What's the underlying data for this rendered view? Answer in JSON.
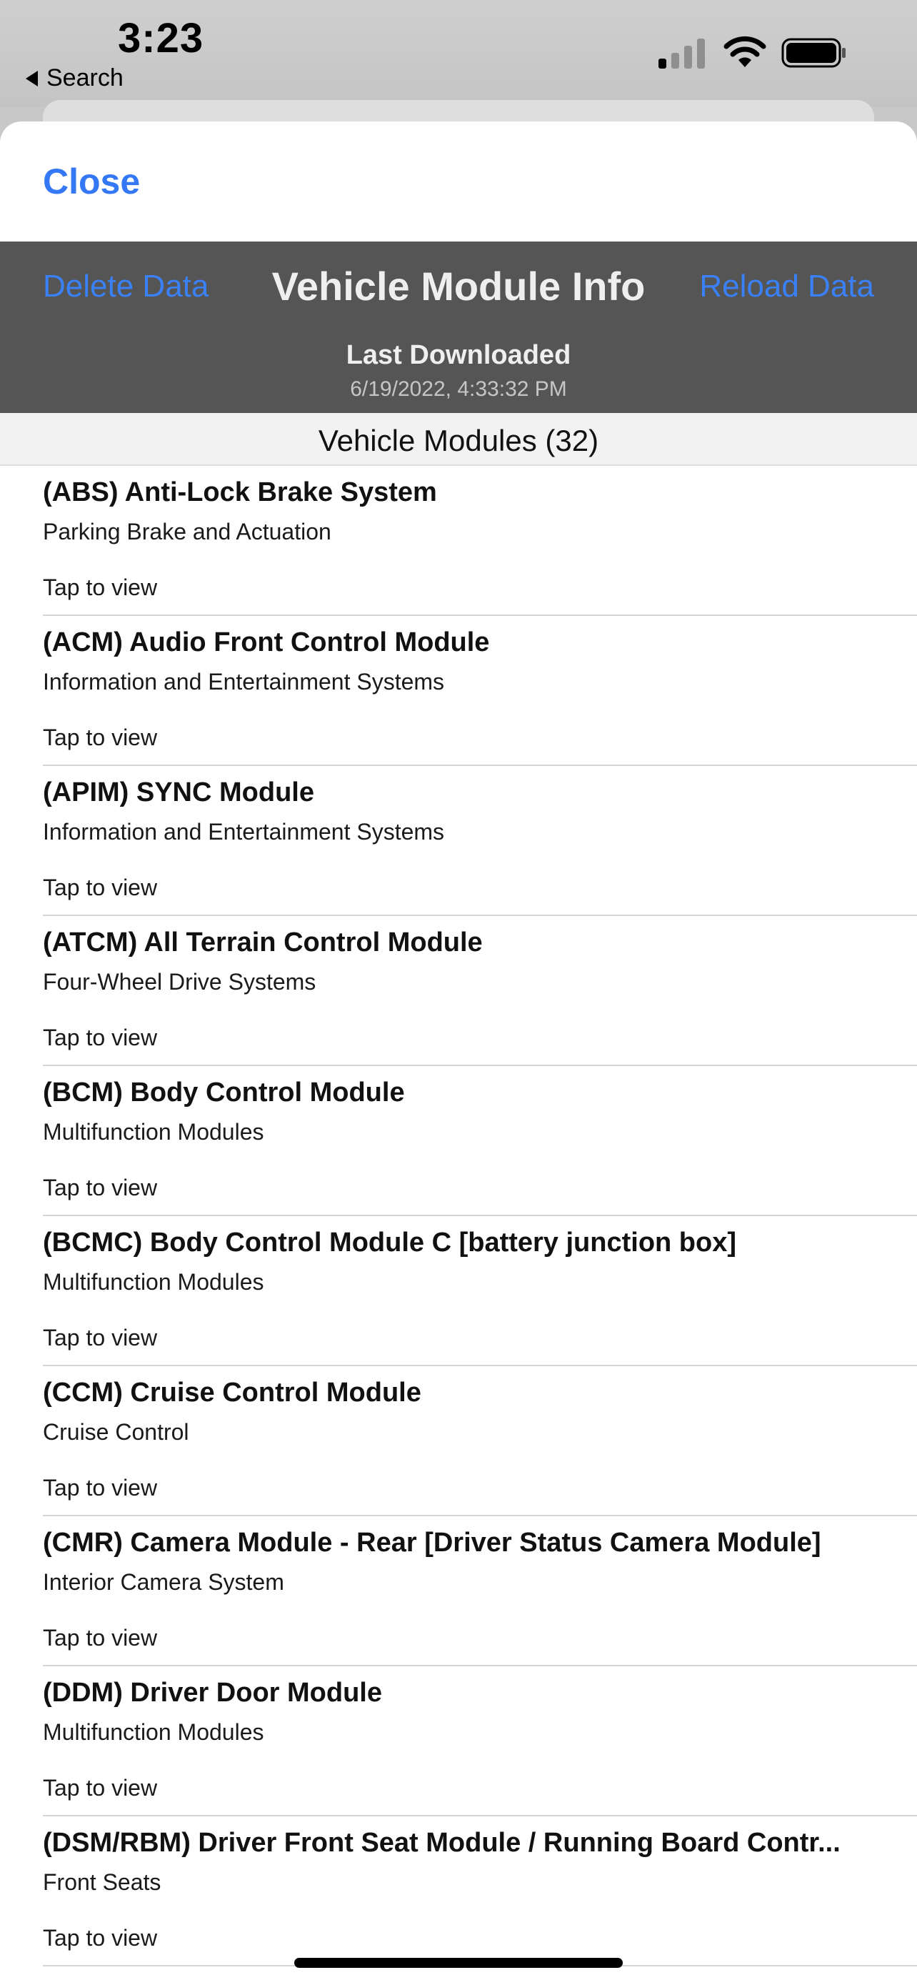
{
  "status_bar": {
    "time": "3:23",
    "back_label": "Search",
    "signal_icon": "cellular-signal-icon",
    "wifi_icon": "wifi-icon",
    "battery_icon": "battery-icon"
  },
  "sheet": {
    "close_label": "Close"
  },
  "header": {
    "delete_label": "Delete Data",
    "title": "Vehicle Module Info",
    "reload_label": "Reload Data",
    "last_downloaded_label": "Last Downloaded",
    "last_downloaded_value": "6/19/2022, 4:33:32 PM",
    "accent_color": "#3478f6",
    "background_color": "#555555"
  },
  "section": {
    "title": "Vehicle Modules (32)"
  },
  "modules": [
    {
      "title": "(ABS) Anti-Lock Brake System",
      "subtitle": "Parking Brake and Actuation",
      "action": "Tap to view"
    },
    {
      "title": "(ACM) Audio Front Control Module",
      "subtitle": "Information and Entertainment Systems",
      "action": "Tap to view"
    },
    {
      "title": "(APIM) SYNC Module",
      "subtitle": "Information and Entertainment Systems",
      "action": "Tap to view"
    },
    {
      "title": "(ATCM) All Terrain Control Module",
      "subtitle": "Four-Wheel Drive Systems",
      "action": "Tap to view"
    },
    {
      "title": "(BCM) Body Control Module",
      "subtitle": "Multifunction Modules",
      "action": "Tap to view"
    },
    {
      "title": "(BCMC) Body Control Module C [battery junction box]",
      "subtitle": "Multifunction Modules",
      "action": "Tap to view"
    },
    {
      "title": "(CCM) Cruise Control Module",
      "subtitle": "Cruise Control",
      "action": "Tap to view"
    },
    {
      "title": "(CMR) Camera Module - Rear [Driver Status Camera Module]",
      "subtitle": "Interior Camera System",
      "action": "Tap to view"
    },
    {
      "title": "(DDM) Driver Door Module",
      "subtitle": "Multifunction Modules",
      "action": "Tap to view"
    },
    {
      "title": "(DSM/RBM) Driver Front Seat Module / Running Board Contr...",
      "subtitle": "Front Seats",
      "action": "Tap to view"
    }
  ]
}
